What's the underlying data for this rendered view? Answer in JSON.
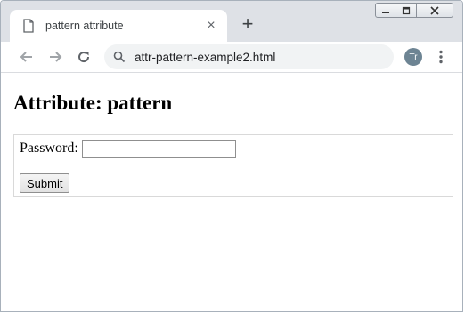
{
  "browser": {
    "tab_title": "pattern attribute",
    "tab_close": "×",
    "new_tab": "+",
    "address": "attr-pattern-example2.html",
    "avatar_initials": "Tr"
  },
  "page": {
    "heading": "Attribute: pattern",
    "password_label": "Password:",
    "password_value": "",
    "submit_label": "Submit"
  }
}
